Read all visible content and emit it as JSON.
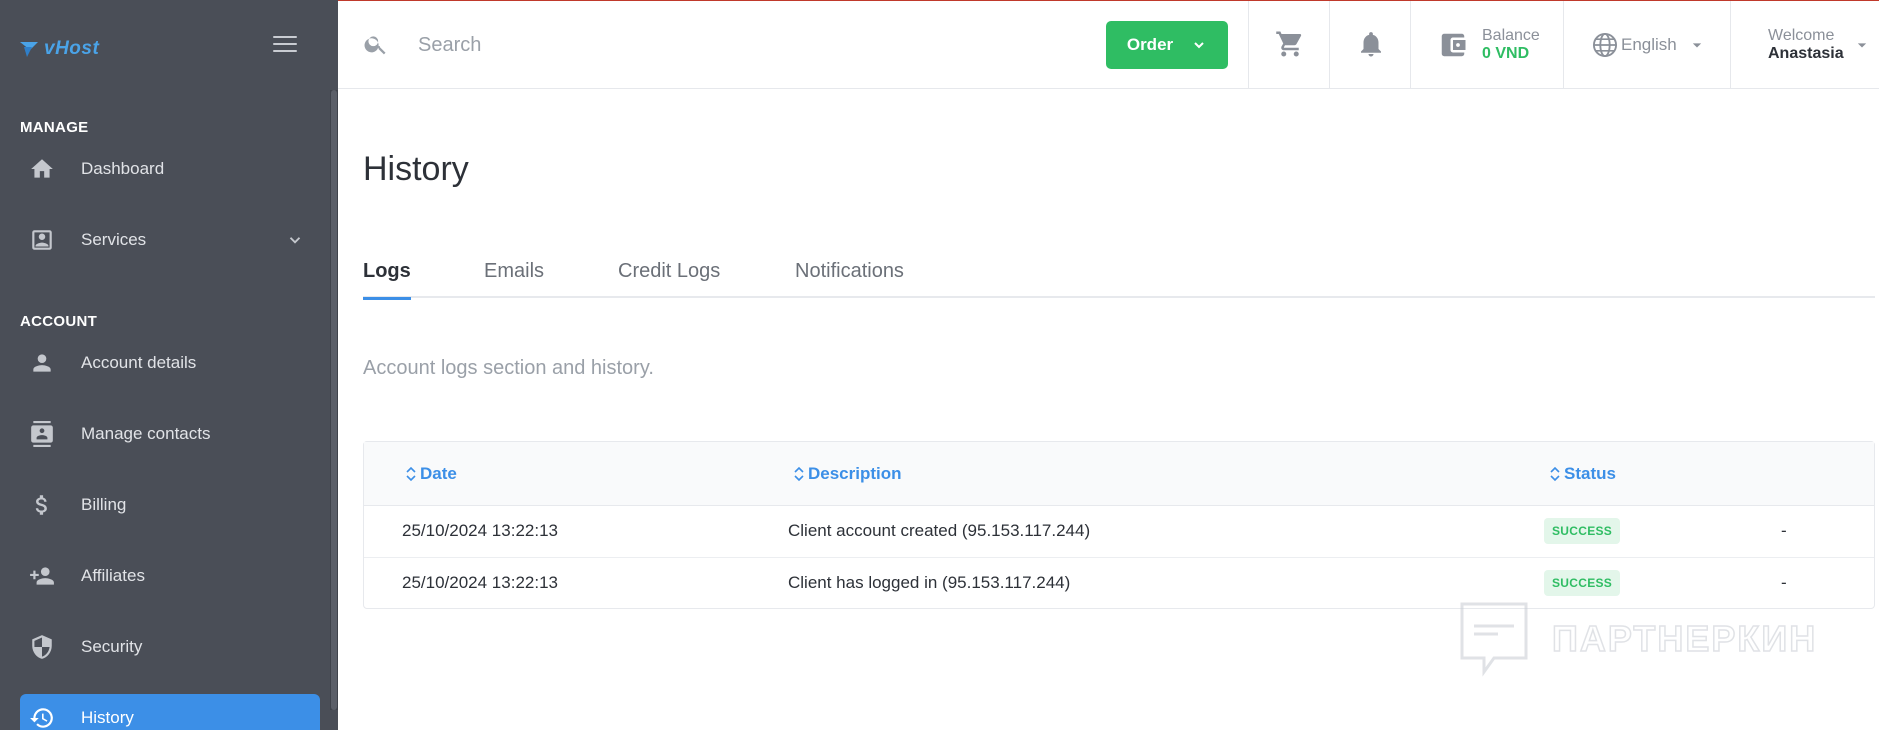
{
  "app": {
    "logo_text": "vHost"
  },
  "sidebar": {
    "sections": [
      {
        "label": "MANAGE"
      },
      {
        "label": "ACCOUNT"
      }
    ],
    "items": [
      {
        "label": "Dashboard",
        "icon": "home-icon"
      },
      {
        "label": "Services",
        "icon": "portrait-icon"
      },
      {
        "label": "Account details",
        "icon": "person-icon"
      },
      {
        "label": "Manage contacts",
        "icon": "contacts-icon"
      },
      {
        "label": "Billing",
        "icon": "dollar-icon"
      },
      {
        "label": "Affiliates",
        "icon": "person-add-icon"
      },
      {
        "label": "Security",
        "icon": "shield-icon"
      },
      {
        "label": "History",
        "icon": "history-icon",
        "active": true
      }
    ]
  },
  "topbar": {
    "search_placeholder": "Search",
    "order_label": "Order",
    "balance_label": "Balance",
    "balance_value": "0 VND",
    "language": "English",
    "welcome_label": "Welcome",
    "user_name": "Anastasia"
  },
  "main": {
    "title": "History",
    "tabs": [
      {
        "label": "Logs",
        "active": true
      },
      {
        "label": "Emails"
      },
      {
        "label": "Credit Logs"
      },
      {
        "label": "Notifications"
      }
    ],
    "subtitle": "Account logs section and history.",
    "table": {
      "headers": [
        "Date",
        "Description",
        "Status"
      ],
      "rows": [
        {
          "date": "25/10/2024 13:22:13",
          "description": "Client account created (95.153.117.244)",
          "status": "SUCCESS",
          "extra": "-"
        },
        {
          "date": "25/10/2024 13:22:13",
          "description": "Client has logged in (95.153.117.244)",
          "status": "SUCCESS",
          "extra": "-"
        }
      ]
    }
  },
  "watermark": {
    "text": "ПАРТНЕРКИН"
  },
  "colors": {
    "sidebar_bg": "#4a4e57",
    "accent": "#3c8fe7",
    "success": "#2fbd63"
  }
}
